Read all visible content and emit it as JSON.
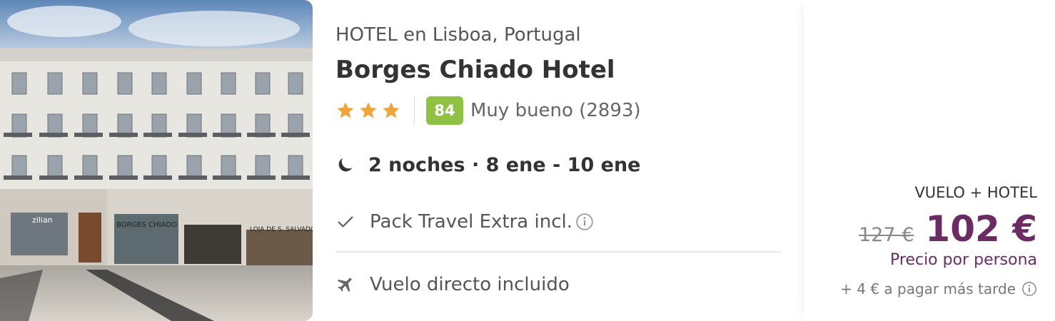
{
  "hotel": {
    "type_location": "HOTEL en Lisboa, Portugal",
    "name": "Borges Chiado Hotel",
    "stars": 3,
    "score": "84",
    "score_label": "Muy bueno (2893)",
    "photo_signs": [
      "zilian",
      "BORGES CHIADO",
      "LOJA DE S. SALVADOR"
    ]
  },
  "stay": {
    "summary": "2 noches · 8 ene - 10 ene"
  },
  "features": [
    {
      "icon": "check-icon",
      "label": "Pack Travel Extra incl."
    },
    {
      "icon": "airplane-icon",
      "label": "Vuelo directo incluido"
    }
  ],
  "price": {
    "package_label": "VUELO + HOTEL",
    "old_price": "127 €",
    "new_price": "102 €",
    "per_person": "Precio por persona",
    "extra": "+ 4 € a pagar más tarde"
  },
  "colors": {
    "score_badge": "#8fc243",
    "price_accent": "#6b2c63",
    "star": "#f2a43a"
  }
}
